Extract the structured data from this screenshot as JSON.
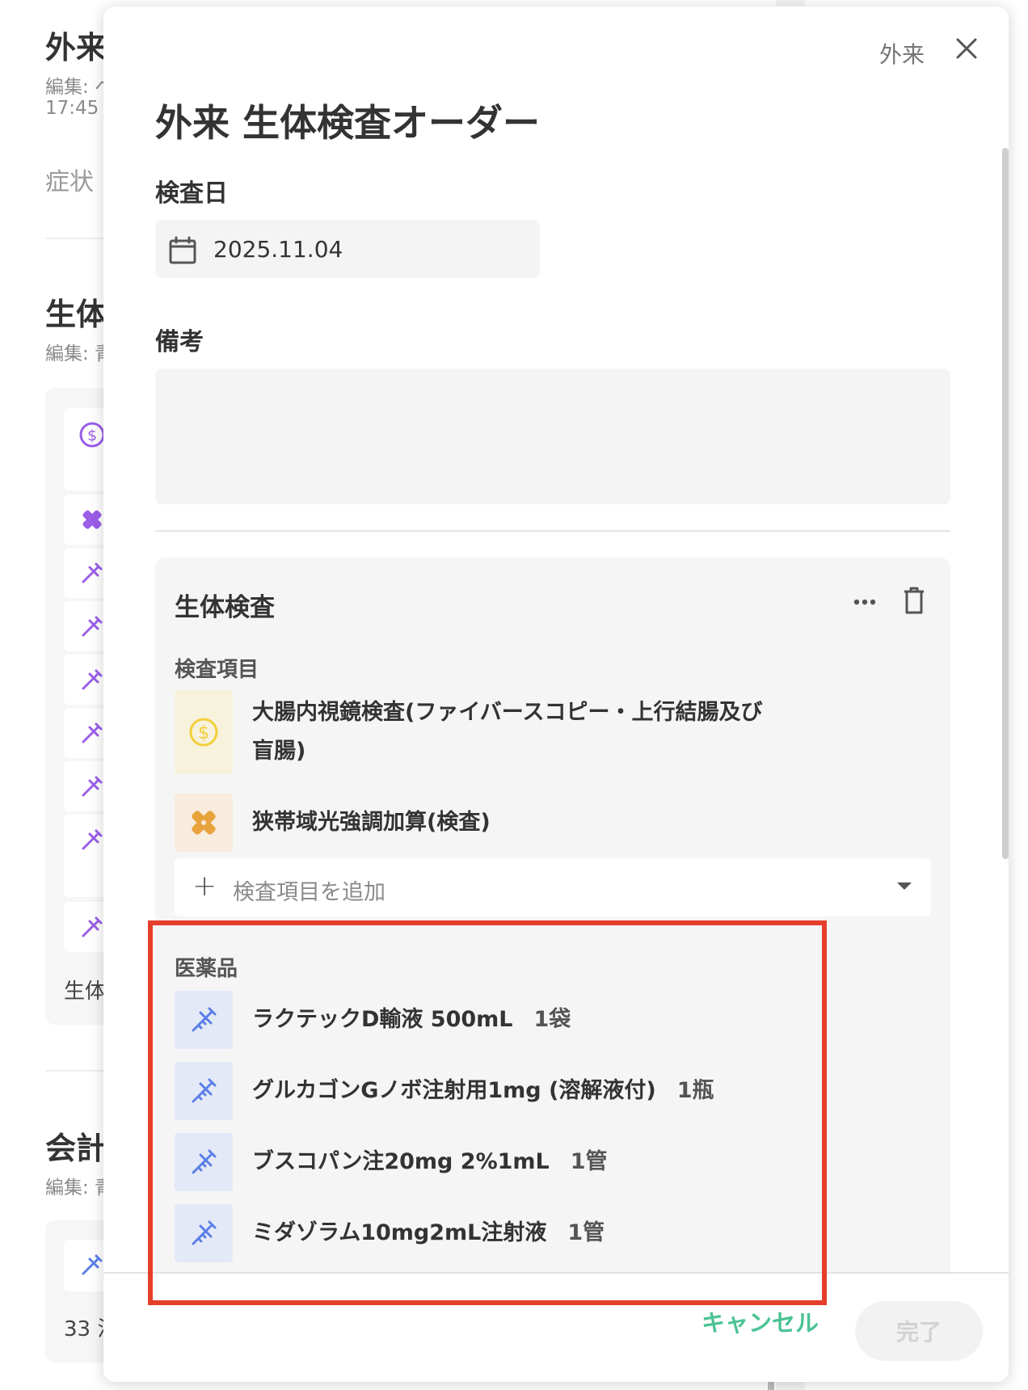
{
  "background": {
    "section1_title": "外来",
    "section1_sub": "編集: ヘ",
    "section1_time": "17:45",
    "section1_field": "症状",
    "section2_title": "生体",
    "section2_sub": "編集: 青",
    "section2_footer": "生体",
    "section3_title": "会計",
    "section3_sub": "編集: 青",
    "section3_text": "33 注"
  },
  "modal": {
    "top_label": "外来",
    "title": "外来 生体検査オーダー",
    "date_label": "検査日",
    "date_value": "2025.11.04",
    "remarks_label": "備考",
    "remarks_value": ""
  },
  "biopsy": {
    "title": "生体検査",
    "exam_label": "検査項目",
    "exams": [
      {
        "line1": "大腸内視鏡検査(ファイバースコピー・上行結腸及び",
        "line2": "盲腸)",
        "icon": "dollar-icon"
      },
      {
        "line1": "狭帯域光強調加算(検査)",
        "icon": "bandage-icon"
      }
    ],
    "add_placeholder": "検査項目を追加",
    "drug_label": "医薬品",
    "drugs": [
      {
        "name": "ラクテックD輸液 500mL",
        "qty": "1袋",
        "icon": "syringe-icon"
      },
      {
        "name": "グルカゴンGノボ注射用1mg (溶解液付)",
        "qty": "1瓶",
        "icon": "syringe-icon"
      },
      {
        "name": "ブスコパン注20mg 2%1mL",
        "qty": "1管",
        "icon": "syringe-icon"
      },
      {
        "name": "ミダゾラム10mg2mL注射液",
        "qty": "1管",
        "icon": "syringe-icon"
      }
    ]
  },
  "footer": {
    "cancel": "キャンセル",
    "done": "完了"
  },
  "colors": {
    "accent_green": "#4cc295",
    "highlight_red": "#e53e2a",
    "drug_icon_blue": "#5b7fe6",
    "bg_icon_purple": "#9b5ee8",
    "dollar_yellow": "#f2cf3a",
    "bandage_orange": "#e8a33d"
  }
}
